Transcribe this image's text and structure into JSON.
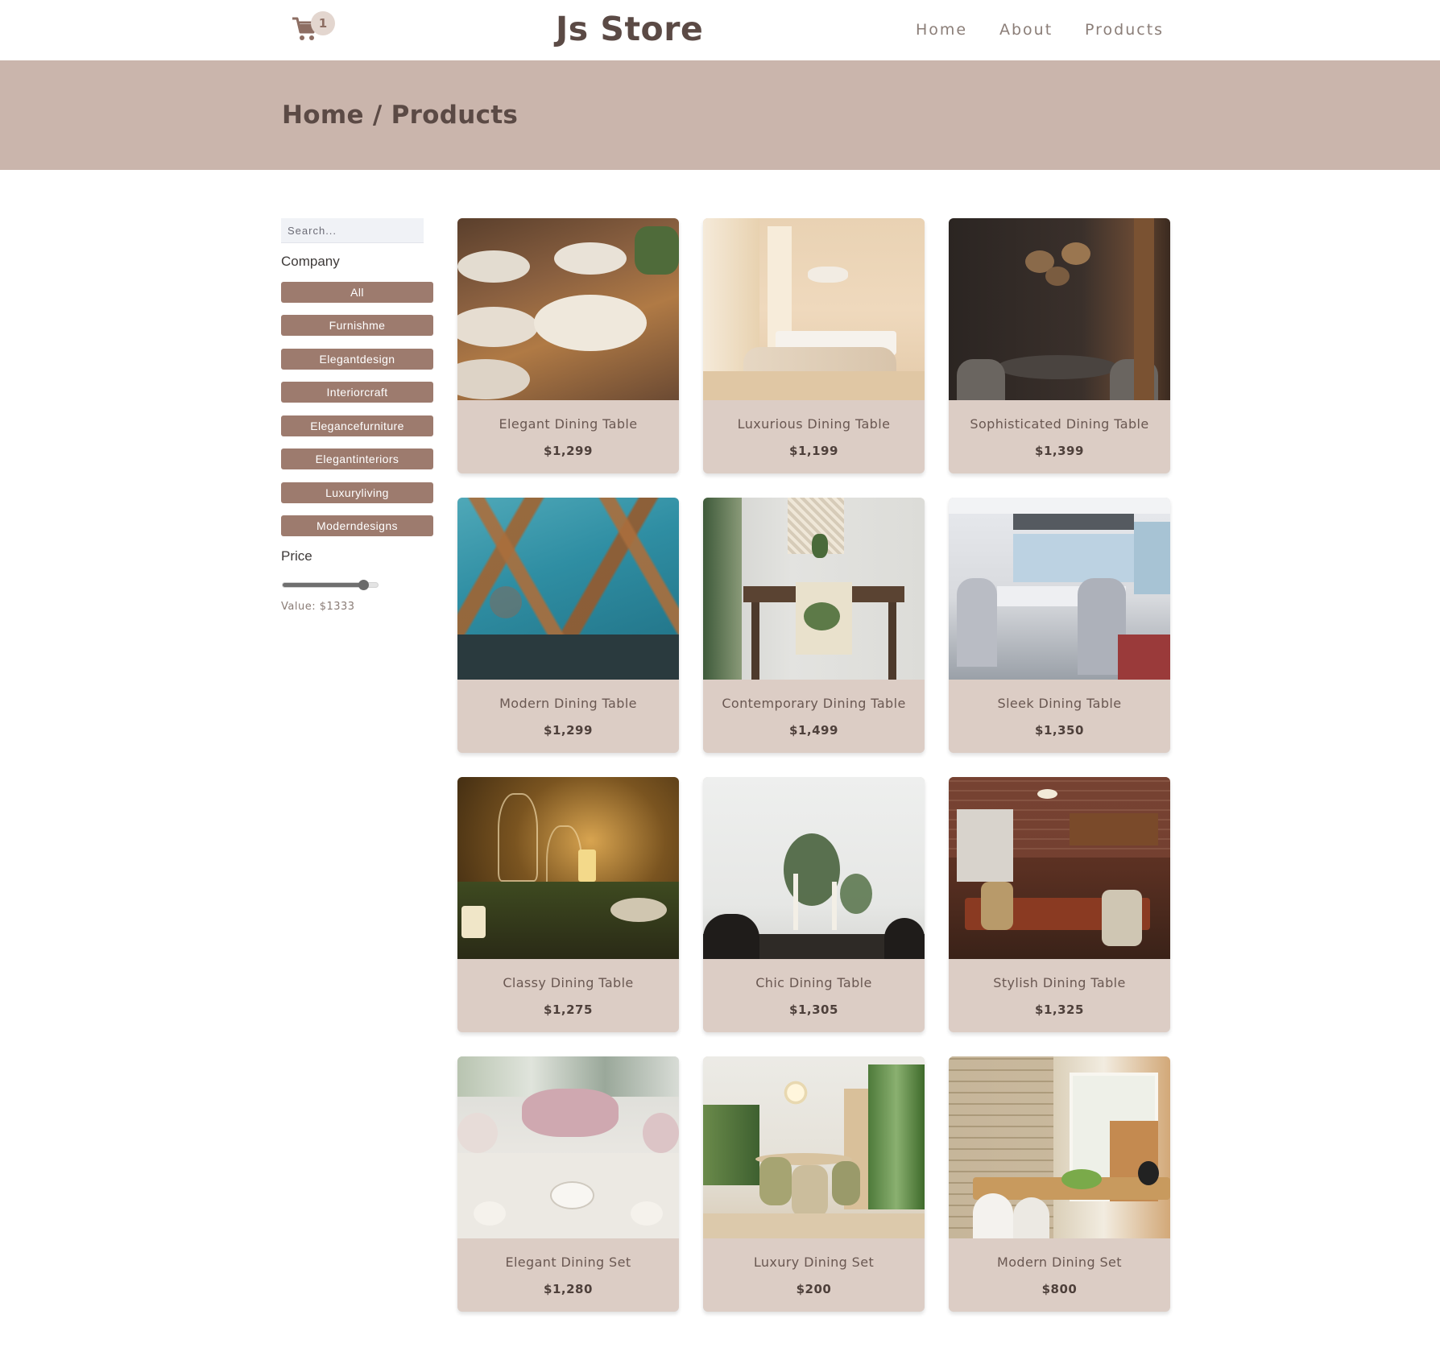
{
  "header": {
    "brand": "Js Store",
    "cart_count": "1",
    "nav": [
      "Home",
      "About",
      "Products"
    ]
  },
  "hero": {
    "breadcrumb": "Home / Products"
  },
  "sidebar": {
    "search_placeholder": "Search...",
    "company_heading": "Company",
    "companies": [
      "All",
      "Furnishme",
      "Elegantdesign",
      "Interiorcraft",
      "Elegancefurniture",
      "Elegantinteriors",
      "Luxuryliving",
      "Moderndesigns"
    ],
    "price_heading": "Price",
    "price_value_text": "Value: $1333",
    "price_slider_fraction": 0.86
  },
  "products": [
    {
      "name": "Elegant Dining Table",
      "price": "$1,299"
    },
    {
      "name": "Luxurious Dining Table",
      "price": "$1,199"
    },
    {
      "name": "Sophisticated Dining Table",
      "price": "$1,399"
    },
    {
      "name": "Modern Dining Table",
      "price": "$1,299"
    },
    {
      "name": "Contemporary Dining Table",
      "price": "$1,499"
    },
    {
      "name": "Sleek Dining Table",
      "price": "$1,350"
    },
    {
      "name": "Classy Dining Table",
      "price": "$1,275"
    },
    {
      "name": "Chic Dining Table",
      "price": "$1,305"
    },
    {
      "name": "Stylish Dining Table",
      "price": "$1,325"
    },
    {
      "name": "Elegant Dining Set",
      "price": "$1,280"
    },
    {
      "name": "Luxury Dining Set",
      "price": "$200"
    },
    {
      "name": "Modern Dining Set",
      "price": "$800"
    }
  ],
  "colors": {
    "accent": "#9d7b6e",
    "hero_band": "#cab5ac",
    "card_bg": "#dccdc5"
  }
}
